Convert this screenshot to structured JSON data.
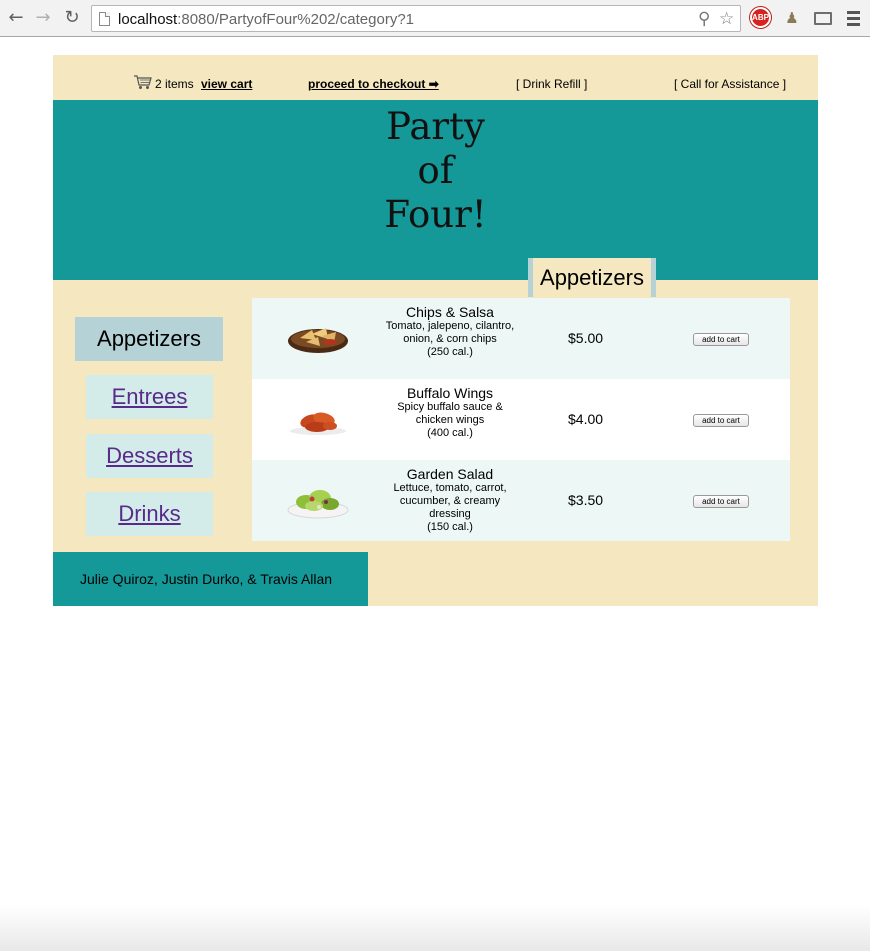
{
  "browser": {
    "url_host": "localhost",
    "url_rest": ":8080/PartyofFour%202/category?1",
    "extension_abp": "ABP"
  },
  "topbar": {
    "cart_count": "2 items",
    "view_cart": "view cart",
    "checkout": "proceed to checkout ➡",
    "drink_refill": "[ Drink Refill ]",
    "assistance": "[ Call for Assistance ]"
  },
  "site": {
    "title_line1": "Party",
    "title_line2": "of",
    "title_line3": "Four!"
  },
  "category_heading": "Appetizers",
  "sidebar": {
    "items": [
      {
        "label": "Appetizers",
        "active": true
      },
      {
        "label": "Entrees",
        "active": false
      },
      {
        "label": "Desserts",
        "active": false
      },
      {
        "label": "Drinks",
        "active": false
      }
    ]
  },
  "menu": {
    "add_label": "add to cart",
    "items": [
      {
        "name": "Chips & Salsa",
        "desc": "Tomato, jalepeno, cilantro, onion, & corn chips",
        "cal": "(250 cal.)",
        "price": "$5.00",
        "image": "chips-salsa-image"
      },
      {
        "name": "Buffalo Wings",
        "desc": "Spicy buffalo sauce & chicken wings",
        "cal": "(400 cal.)",
        "price": "$4.00",
        "image": "buffalo-wings-image"
      },
      {
        "name": "Garden Salad",
        "desc": "Lettuce, tomato, carrot, cucumber, & creamy dressing",
        "cal": "(150 cal.)",
        "price": "$3.50",
        "image": "garden-salad-image"
      }
    ]
  },
  "footer": {
    "credits": "Julie Quiroz, Justin Durko, & Travis Allan"
  }
}
